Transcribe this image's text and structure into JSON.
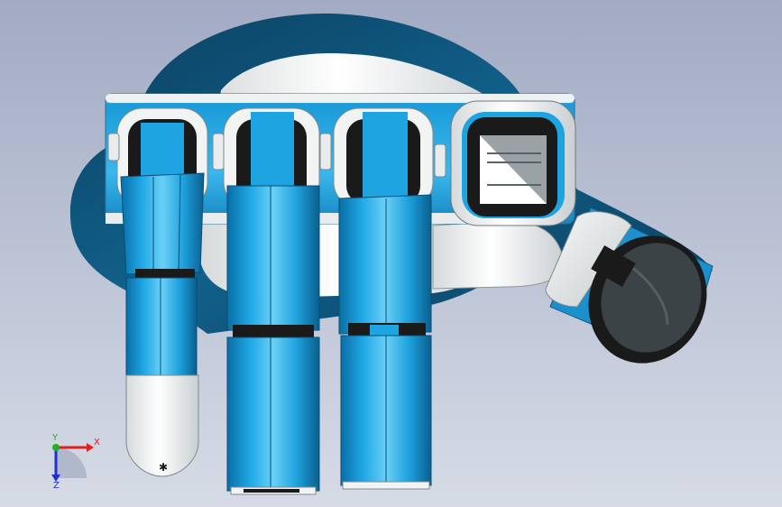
{
  "viewport": {
    "background_top": "#a2abc4",
    "background_bottom": "#d6dbe6",
    "model_palette": {
      "cyan": "#1a9ad6",
      "cyan_light": "#5fc6f0",
      "cyan_dark": "#0a5f8f",
      "white": "#f4f6f6",
      "navy": "#0b4a6e",
      "black": "#1a1a1a"
    }
  },
  "triad": {
    "x_label": "X",
    "y_label": "Y",
    "z_label": "Z",
    "x_color": "#e02020",
    "y_color": "#20b020",
    "z_color": "#2030d0"
  }
}
